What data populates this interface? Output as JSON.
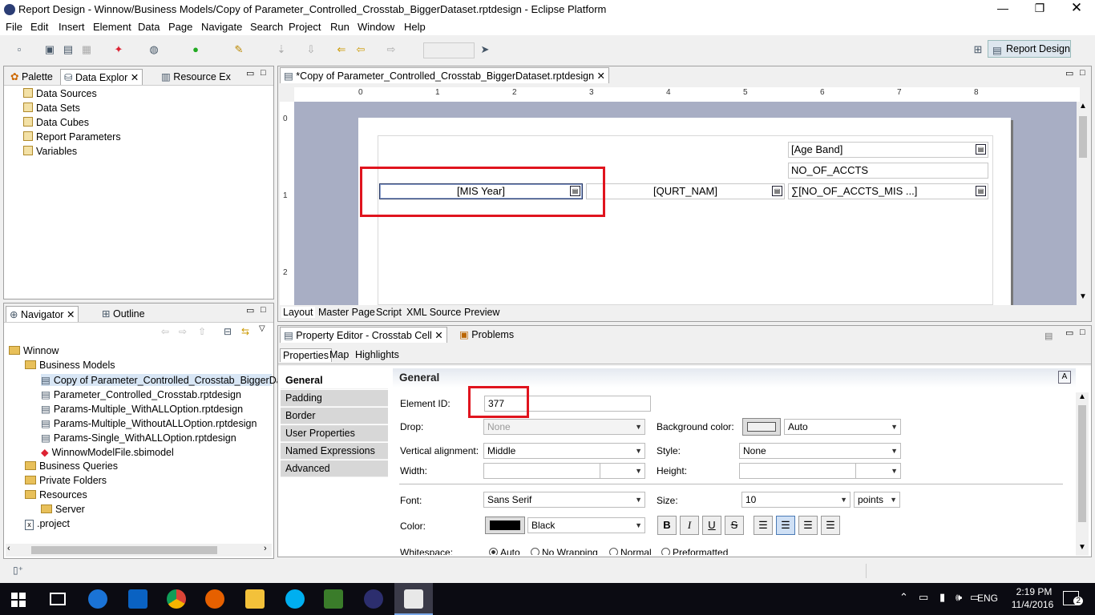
{
  "window": {
    "title": "Report Design - Winnow/Business Models/Copy of Parameter_Controlled_Crosstab_BiggerDataset.rptdesign - Eclipse Platform",
    "min_icon": "minimize-icon",
    "max_icon": "restore-icon",
    "close_icon": "close-icon"
  },
  "menu": [
    "File",
    "Edit",
    "Insert",
    "Element",
    "Data",
    "Page",
    "Navigate",
    "Search",
    "Project",
    "Run",
    "Window",
    "Help"
  ],
  "perspective": {
    "label": "Report Design"
  },
  "left_top": {
    "tabs": [
      "Palette",
      "Data Explor",
      "Resource Ex"
    ],
    "items": [
      "Data Sources",
      "Data Sets",
      "Data Cubes",
      "Report Parameters",
      "Variables"
    ]
  },
  "navigator": {
    "tabs": [
      "Navigator",
      "Outline"
    ],
    "tree": [
      {
        "label": "Winnow",
        "level": 0,
        "kind": "folder"
      },
      {
        "label": "Business Models",
        "level": 1,
        "kind": "folder"
      },
      {
        "label": "Copy of Parameter_Controlled_Crosstab_BiggerDat",
        "level": 2,
        "kind": "file",
        "selected": true
      },
      {
        "label": "Parameter_Controlled_Crosstab.rptdesign",
        "level": 2,
        "kind": "file"
      },
      {
        "label": "Params-Multiple_WithALLOption.rptdesign",
        "level": 2,
        "kind": "file"
      },
      {
        "label": "Params-Multiple_WithoutALLOption.rptdesign",
        "level": 2,
        "kind": "file"
      },
      {
        "label": "Params-Single_WithALLOption.rptdesign",
        "level": 2,
        "kind": "file"
      },
      {
        "label": "WinnowModelFile.sbimodel",
        "level": 2,
        "kind": "model"
      },
      {
        "label": "Business Queries",
        "level": 1,
        "kind": "folder"
      },
      {
        "label": "Private Folders",
        "level": 1,
        "kind": "folder"
      },
      {
        "label": "Resources",
        "level": 1,
        "kind": "folder"
      },
      {
        "label": "Server",
        "level": 2,
        "kind": "folder"
      },
      {
        "label": ".project",
        "level": 1,
        "kind": "xfile"
      }
    ]
  },
  "editor": {
    "tab": "*Copy of Parameter_Controlled_Crosstab_BiggerDataset.rptdesign",
    "ruler_numbers": [
      "0",
      "1",
      "2",
      "3",
      "4",
      "5",
      "6",
      "7",
      "8"
    ],
    "vruler_numbers": [
      "0",
      "1",
      "2"
    ],
    "crosstab": {
      "age_band": "[Age Band]",
      "measure_header": "NO_OF_ACCTS",
      "row_dim1": "[MIS Year]",
      "row_dim2": "[QURT_NAM]",
      "measure_cell": "∑[NO_OF_ACCTS_MIS ...]"
    },
    "bottom_tabs": [
      "Layout",
      "Master Page",
      "Script",
      "XML Source",
      "Preview"
    ]
  },
  "property_editor": {
    "title": "Property Editor - Crosstab Cell",
    "problems_tab": "Problems",
    "subtabs": [
      "Properties",
      "Map",
      "Highlights"
    ],
    "categories": [
      "General",
      "Padding",
      "Border",
      "User Properties",
      "Named Expressions",
      "Advanced"
    ],
    "section_title": "General",
    "fields": {
      "element_id_label": "Element ID:",
      "element_id_value": "377",
      "drop_label": "Drop:",
      "drop_value": "None",
      "background_label": "Background color:",
      "background_value": "Auto",
      "valign_label": "Vertical alignment:",
      "valign_value": "Middle",
      "style_label": "Style:",
      "style_value": "None",
      "width_label": "Width:",
      "height_label": "Height:",
      "font_label": "Font:",
      "font_value": "Sans Serif",
      "size_label": "Size:",
      "size_value": "10",
      "size_unit": "points",
      "color_label": "Color:",
      "color_value": "Black",
      "whitespace_label": "Whitespace:",
      "ws_options": [
        "Auto",
        "No Wrapping",
        "Normal",
        "Preformatted"
      ]
    },
    "format_buttons": [
      "B",
      "I",
      "U",
      "S"
    ]
  },
  "taskbar": {
    "time": "2:19 PM",
    "date": "11/4/2016",
    "lang": "ENG",
    "notifications": "2"
  },
  "colors": {
    "accent": "#2a6bb5",
    "highlight_red": "#e0141e",
    "canvas_bg": "#a8aec4"
  }
}
